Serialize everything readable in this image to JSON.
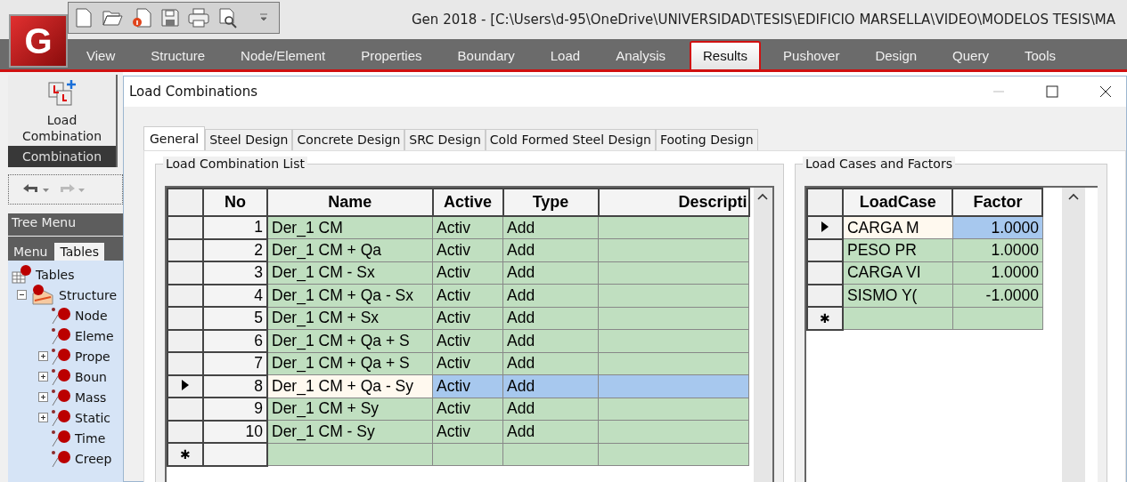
{
  "app_logo": {
    "letter": "G"
  },
  "window": {
    "title": "Gen 2018 - [C:\\Users\\d-95\\OneDrive\\UNIVERSIDAD\\TESIS\\EDIFICIO MARSELLA\\VIDEO\\MODELOS TESIS\\MA"
  },
  "ribbon_tabs": [
    {
      "label": "View",
      "selected": false
    },
    {
      "label": "Structure",
      "selected": false
    },
    {
      "label": "Node/Element",
      "selected": false
    },
    {
      "label": "Properties",
      "selected": false
    },
    {
      "label": "Boundary",
      "selected": false
    },
    {
      "label": "Load",
      "selected": false
    },
    {
      "label": "Analysis",
      "selected": false
    },
    {
      "label": "Results",
      "selected": true
    },
    {
      "label": "Pushover",
      "selected": false
    },
    {
      "label": "Design",
      "selected": false
    },
    {
      "label": "Query",
      "selected": false
    },
    {
      "label": "Tools",
      "selected": false
    }
  ],
  "ribbon_button": {
    "label": "Load Combination",
    "group": "Combination"
  },
  "history": {
    "undo_disabled": false,
    "redo_disabled": true
  },
  "tree_menu": {
    "title": "Tree Menu",
    "tabs": [
      {
        "label": "Menu",
        "selected": false
      },
      {
        "label": "Tables",
        "selected": true
      }
    ],
    "items": [
      {
        "label": "Tables",
        "children": [
          {
            "label": "Structure",
            "expanded": true,
            "children": [
              {
                "label": "Node"
              },
              {
                "label": "Eleme"
              },
              {
                "label": "Prope",
                "expanded": false
              },
              {
                "label": "Boun",
                "expanded": false
              },
              {
                "label": "Mass",
                "expanded": false
              },
              {
                "label": "Static",
                "expanded": false
              },
              {
                "label": "Time"
              },
              {
                "label": "Creep"
              }
            ]
          }
        ]
      }
    ]
  },
  "dialog": {
    "title": "Load Combinations",
    "minimize_disabled": true,
    "tabs": [
      {
        "label": "General",
        "selected": true
      },
      {
        "label": "Steel Design",
        "selected": false
      },
      {
        "label": "Concrete Design",
        "selected": false
      },
      {
        "label": "SRC Design",
        "selected": false
      },
      {
        "label": "Cold Formed Steel Design",
        "selected": false
      },
      {
        "label": "Footing Design",
        "selected": false
      }
    ],
    "combination_list": {
      "title": "Load Combination List",
      "columns": [
        "No",
        "Name",
        "Active",
        "Type",
        "Descripti"
      ],
      "new_row_marker": "✱",
      "rows": [
        {
          "cells": [
            "1",
            "Der_1 CM",
            "Activ",
            "Add"
          ],
          "selected": false
        },
        {
          "cells": [
            "2",
            "Der_1 CM + Qa",
            "Activ",
            "Add"
          ],
          "selected": false
        },
        {
          "cells": [
            "3",
            "Der_1 CM - Sx",
            "Activ",
            "Add"
          ],
          "selected": false
        },
        {
          "cells": [
            "4",
            "Der_1 CM + Qa - Sx",
            "Activ",
            "Add"
          ],
          "selected": false
        },
        {
          "cells": [
            "5",
            "Der_1 CM + Sx",
            "Activ",
            "Add"
          ],
          "selected": false
        },
        {
          "cells": [
            "6",
            "Der_1 CM + Qa + S",
            "Activ",
            "Add"
          ],
          "selected": false
        },
        {
          "cells": [
            "7",
            "Der_1 CM + Qa + S",
            "Activ",
            "Add"
          ],
          "selected": false
        },
        {
          "cells": [
            "8",
            "Der_1 CM + Qa - Sy",
            "Activ",
            "Add"
          ],
          "selected": true
        },
        {
          "cells": [
            "9",
            "Der_1 CM + Sy",
            "Activ",
            "Add"
          ],
          "selected": false
        },
        {
          "cells": [
            "10",
            "Der_1 CM - Sy",
            "Activ",
            "Add"
          ],
          "selected": false
        }
      ]
    },
    "load_cases": {
      "title": "Load Cases and Factors",
      "columns": [
        "LoadCase",
        "Factor"
      ],
      "new_row_marker": "✱",
      "rows": [
        {
          "cells": [
            "CARGA M",
            "1.0000"
          ],
          "selected": true
        },
        {
          "cells": [
            "PESO PR",
            "1.0000"
          ],
          "selected": false
        },
        {
          "cells": [
            "CARGA VI",
            "1.0000"
          ],
          "selected": false
        },
        {
          "cells": [
            "SISMO Y(",
            "-1.0000"
          ],
          "selected": false
        }
      ]
    }
  }
}
